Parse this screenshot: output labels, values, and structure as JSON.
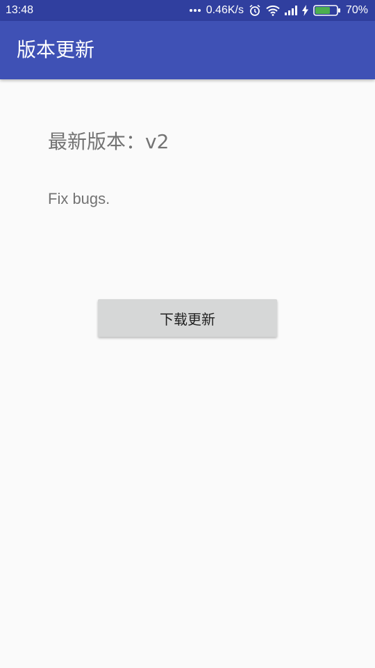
{
  "status_bar": {
    "time": "13:48",
    "network_speed": "0.46K/s",
    "battery_percent": "70%",
    "battery_level": 0.7,
    "battery_color": "#4caf50",
    "icons": [
      "more-dots-icon",
      "alarm-icon",
      "wifi-icon",
      "signal-icon",
      "charging-bolt-icon",
      "battery-icon"
    ]
  },
  "app_bar": {
    "title": "版本更新",
    "color": "#3f51b5"
  },
  "update": {
    "version_label": "最新版本：",
    "version_value": "v2",
    "release_notes": "Fix bugs.",
    "download_button_label": "下载更新"
  }
}
